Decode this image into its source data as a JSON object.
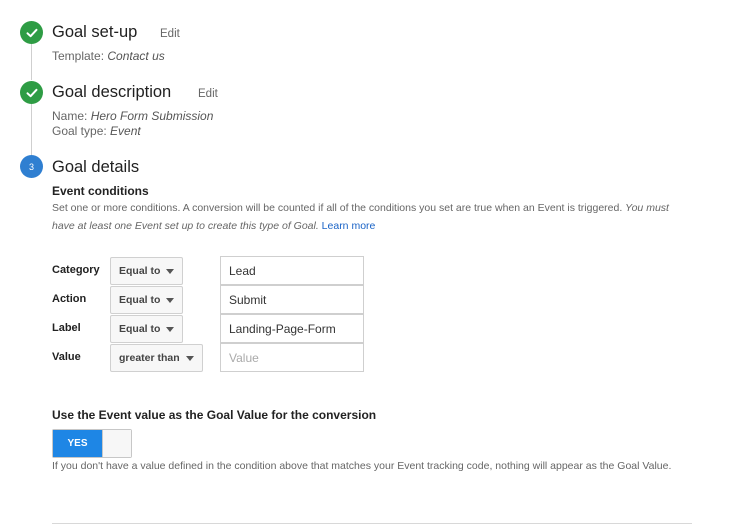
{
  "steps": [
    {
      "status": "done",
      "title": "Goal set-up",
      "edit_label": "Edit",
      "meta": [
        {
          "label": "Template:",
          "value": "Contact us"
        }
      ]
    },
    {
      "status": "done",
      "title": "Goal description",
      "edit_label": "Edit",
      "meta": [
        {
          "label": "Name:",
          "value": "Hero Form Submission"
        },
        {
          "label": "Goal type:",
          "value": "Event"
        }
      ]
    },
    {
      "status": "current",
      "number": "3",
      "title": "Goal details"
    }
  ],
  "event_conditions": {
    "heading": "Event conditions",
    "description": "Set one or more conditions. A conversion will be counted if all of the conditions you set are true when an Event is triggered.",
    "description_italic": "You must have at least one Event set up to create this type of Goal.",
    "learn_more": "Learn more",
    "rows": [
      {
        "label": "Category",
        "operator": "Equal to",
        "value": "Lead",
        "placeholder": ""
      },
      {
        "label": "Action",
        "operator": "Equal to",
        "value": "Submit",
        "placeholder": ""
      },
      {
        "label": "Label",
        "operator": "Equal to",
        "value": "Landing-Page-Form",
        "placeholder": ""
      },
      {
        "label": "Value",
        "operator": "greater than",
        "value": "",
        "placeholder": "Value"
      }
    ]
  },
  "use_event_value": {
    "heading": "Use the Event value as the Goal Value for the conversion",
    "toggle_label": "YES",
    "toggle_on": true,
    "help": "If you don't have a value defined in the condition above that matches your Event tracking code, nothing will appear as the Goal Value."
  },
  "colors": {
    "done": "#2e9c44",
    "current": "#2f7fd1",
    "toggle_on": "#1e86e5",
    "link": "#1a63c6"
  }
}
